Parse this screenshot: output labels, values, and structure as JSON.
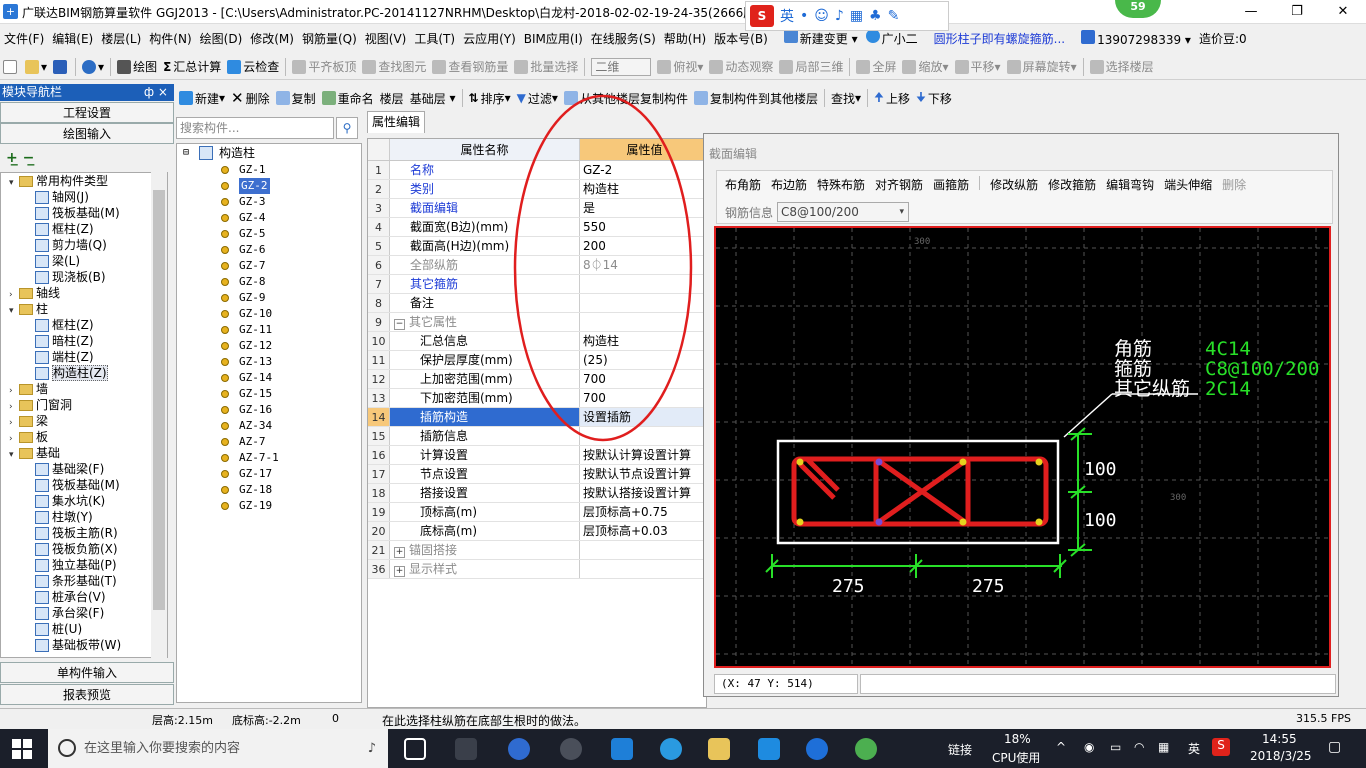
{
  "window": {
    "title": "广联达BIM钢筋算量软件 GGJ2013 - [C:\\Users\\Administrator.PC-20141127NRHM\\Desktop\\白龙村-2018-02-02-19-24-35(2666版",
    "badge": "59",
    "ime": {
      "label": "英"
    }
  },
  "menu": {
    "items": [
      "文件(F)",
      "编辑(E)",
      "楼层(L)",
      "构件(N)",
      "绘图(D)",
      "修改(M)",
      "钢筋量(Q)",
      "视图(V)",
      "工具(T)",
      "云应用(Y)",
      "BIM应用(I)",
      "在线服务(S)",
      "帮助(H)",
      "版本号(B)"
    ],
    "new_change": "新建变更",
    "guangxiaoer": "广小二",
    "link": "圆形柱子即有螺旋箍筋...",
    "phone": "13907298339",
    "price": "造价豆:0"
  },
  "toolbar1": {
    "draw": "绘图",
    "sum": "汇总计算",
    "cloud_check": "云检查",
    "flat_top": "平齐板顶",
    "find_elem": "查找图元",
    "view_rebar": "查看钢筋量",
    "batch_select": "批量选择",
    "view_mode": "二维",
    "top_view": "俯视",
    "dynamic": "动态观察",
    "partial3d": "局部三维",
    "fullscreen": "全屏",
    "zoom": "缩放",
    "pan": "平移",
    "rotate": "屏幕旋转",
    "select_floor": "选择楼层"
  },
  "toolbar2": {
    "new": "新建",
    "delete": "删除",
    "copy": "复制",
    "rename": "重命名",
    "floor_label": "楼层",
    "floor_value": "基础层",
    "sort": "排序",
    "filter": "过滤",
    "copy_from": "从其他楼层复制构件",
    "copy_to": "复制构件到其他楼层",
    "find": "查找",
    "move_up": "上移",
    "move_down": "下移"
  },
  "nav": {
    "header": "模块导航栏",
    "pin": "ф ×",
    "project_settings": "工程设置",
    "draw_input": "绘图输入",
    "single_input": "单构件输入",
    "report_preview": "报表预览",
    "tree": [
      {
        "level": 0,
        "exp": "▾",
        "folder": true,
        "label": "常用构件类型"
      },
      {
        "level": 1,
        "label": "轴网(J)"
      },
      {
        "level": 1,
        "label": "筏板基础(M)"
      },
      {
        "level": 1,
        "label": "框柱(Z)"
      },
      {
        "level": 1,
        "label": "剪力墙(Q)"
      },
      {
        "level": 1,
        "label": "梁(L)"
      },
      {
        "level": 1,
        "label": "现浇板(B)"
      },
      {
        "level": 0,
        "exp": "›",
        "folder": true,
        "label": "轴线"
      },
      {
        "level": 0,
        "exp": "▾",
        "folder": true,
        "label": "柱"
      },
      {
        "level": 1,
        "label": "框柱(Z)"
      },
      {
        "level": 1,
        "label": "暗柱(Z)"
      },
      {
        "level": 1,
        "label": "端柱(Z)"
      },
      {
        "level": 1,
        "label": "构造柱(Z)",
        "sel": true
      },
      {
        "level": 0,
        "exp": "›",
        "folder": true,
        "label": "墙"
      },
      {
        "level": 0,
        "exp": "›",
        "folder": true,
        "label": "门窗洞"
      },
      {
        "level": 0,
        "exp": "›",
        "folder": true,
        "label": "梁"
      },
      {
        "level": 0,
        "exp": "›",
        "folder": true,
        "label": "板"
      },
      {
        "level": 0,
        "exp": "▾",
        "folder": true,
        "label": "基础"
      },
      {
        "level": 1,
        "label": "基础梁(F)"
      },
      {
        "level": 1,
        "label": "筏板基础(M)"
      },
      {
        "level": 1,
        "label": "集水坑(K)"
      },
      {
        "level": 1,
        "label": "柱墩(Y)"
      },
      {
        "level": 1,
        "label": "筏板主筋(R)"
      },
      {
        "level": 1,
        "label": "筏板负筋(X)"
      },
      {
        "level": 1,
        "label": "独立基础(P)"
      },
      {
        "level": 1,
        "label": "条形基础(T)"
      },
      {
        "level": 1,
        "label": "桩承台(V)"
      },
      {
        "level": 1,
        "label": "承台梁(F)"
      },
      {
        "level": 1,
        "label": "桩(U)"
      },
      {
        "level": 1,
        "label": "基础板带(W)"
      }
    ]
  },
  "components": {
    "search_placeholder": "搜索构件...",
    "root": "构造柱",
    "items": [
      "GZ-1",
      "GZ-2",
      "GZ-3",
      "GZ-4",
      "GZ-5",
      "GZ-6",
      "GZ-7",
      "GZ-8",
      "GZ-9",
      "GZ-10",
      "GZ-11",
      "GZ-12",
      "GZ-13",
      "GZ-14",
      "GZ-15",
      "GZ-16",
      "AZ-34",
      "AZ-7",
      "AZ-7-1",
      "GZ-17",
      "GZ-18",
      "GZ-19"
    ],
    "selected": "GZ-2"
  },
  "props": {
    "tab": "属性编辑",
    "col_name": "属性名称",
    "col_value": "属性值",
    "rows": [
      {
        "n": "1",
        "k": "名称",
        "v": "GZ-2",
        "style": "blue"
      },
      {
        "n": "2",
        "k": "类别",
        "v": "构造柱",
        "style": "blue"
      },
      {
        "n": "3",
        "k": "截面编辑",
        "v": "是",
        "style": "blue"
      },
      {
        "n": "4",
        "k": "截面宽(B边)(mm)",
        "v": "550",
        "style": ""
      },
      {
        "n": "5",
        "k": "截面高(H边)(mm)",
        "v": "200",
        "style": ""
      },
      {
        "n": "6",
        "k": "全部纵筋",
        "v": "8⏀14",
        "style": "grey"
      },
      {
        "n": "7",
        "k": "其它箍筋",
        "v": "",
        "style": "blue"
      },
      {
        "n": "8",
        "k": "备注",
        "v": "",
        "style": ""
      },
      {
        "n": "9",
        "k": "其它属性",
        "v": "",
        "style": "grey",
        "group": "−"
      },
      {
        "n": "10",
        "k": "汇总信息",
        "v": "构造柱",
        "style": "",
        "indent": true
      },
      {
        "n": "11",
        "k": "保护层厚度(mm)",
        "v": "(25)",
        "style": "",
        "indent": true
      },
      {
        "n": "12",
        "k": "上加密范围(mm)",
        "v": "700",
        "style": "",
        "indent": true
      },
      {
        "n": "13",
        "k": "下加密范围(mm)",
        "v": "700",
        "style": "",
        "indent": true
      },
      {
        "n": "14",
        "k": "插筋构造",
        "v": "设置插筋",
        "style": "",
        "indent": true,
        "sel": true
      },
      {
        "n": "15",
        "k": "插筋信息",
        "v": "",
        "style": "",
        "indent": true
      },
      {
        "n": "16",
        "k": "计算设置",
        "v": "按默认计算设置计算",
        "style": "",
        "indent": true
      },
      {
        "n": "17",
        "k": "节点设置",
        "v": "按默认节点设置计算",
        "style": "",
        "indent": true
      },
      {
        "n": "18",
        "k": "搭接设置",
        "v": "按默认搭接设置计算",
        "style": "",
        "indent": true
      },
      {
        "n": "19",
        "k": "顶标高(m)",
        "v": "层顶标高+0.75",
        "style": "",
        "indent": true
      },
      {
        "n": "20",
        "k": "底标高(m)",
        "v": "层顶标高+0.03",
        "style": "",
        "indent": true
      },
      {
        "n": "21",
        "k": "锚固搭接",
        "v": "",
        "style": "grey",
        "group": "+"
      },
      {
        "n": "36",
        "k": "显示样式",
        "v": "",
        "style": "grey",
        "group": "+"
      }
    ]
  },
  "section": {
    "title": "截面编辑",
    "tools": [
      "布角筋",
      "布边筋",
      "特殊布筋",
      "对齐钢筋",
      "画箍筋",
      "修改纵筋",
      "修改箍筋",
      "编辑弯钩",
      "端头伸缩",
      "删除"
    ],
    "rebar_info_label": "钢筋信息",
    "rebar_info_value": "C8@100/200",
    "labels": {
      "corner": "角筋",
      "stirrup": "箍筋",
      "other": "其它纵筋"
    },
    "values": {
      "corner": "4C14",
      "stirrup": "C8@100/200",
      "other": "2C14"
    },
    "dims": {
      "h1": "100",
      "h2": "100",
      "w1": "275",
      "w2": "275",
      "grid_top": "300",
      "grid_right": "300"
    },
    "coords": "(X: 47 Y: 514)"
  },
  "status": {
    "floor_height": "层高:2.15m",
    "bottom_elev": "底标高:-2.2m",
    "zero": "0",
    "hint": "在此选择柱纵筋在底部生根时的做法。",
    "fps": "315.5 FPS"
  },
  "taskbar": {
    "search": "在这里输入你要搜索的内容",
    "link": "链接",
    "cpu": "18%",
    "cpu_label": "CPU使用",
    "lang": "英",
    "time": "14:55",
    "date": "2018/3/25"
  },
  "colors": {
    "accent": "#1c5fb8",
    "red": "#e01e1e",
    "green": "#28e028"
  }
}
